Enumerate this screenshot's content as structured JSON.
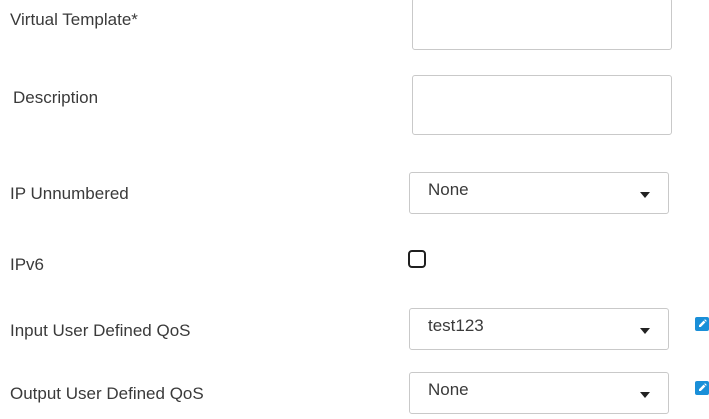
{
  "form": {
    "virtual_template": {
      "label": "Virtual Template*",
      "value": "",
      "placeholder": ""
    },
    "description": {
      "label": "Description",
      "value": "",
      "placeholder": ""
    },
    "ip_unnumbered": {
      "label": "IP Unnumbered",
      "selected": "None"
    },
    "ipv6": {
      "label": "IPv6",
      "checked": false
    },
    "input_qos": {
      "label": "Input User Defined QoS",
      "selected": "test123"
    },
    "output_qos": {
      "label": "Output User Defined QoS",
      "selected": "None"
    }
  },
  "icons": {
    "edit": "edit-icon",
    "dropdown": "chevron-down-icon"
  },
  "colors": {
    "accent": "#1a8fd8",
    "border": "#c9c9c9",
    "label_text": "#3a3a3a"
  }
}
